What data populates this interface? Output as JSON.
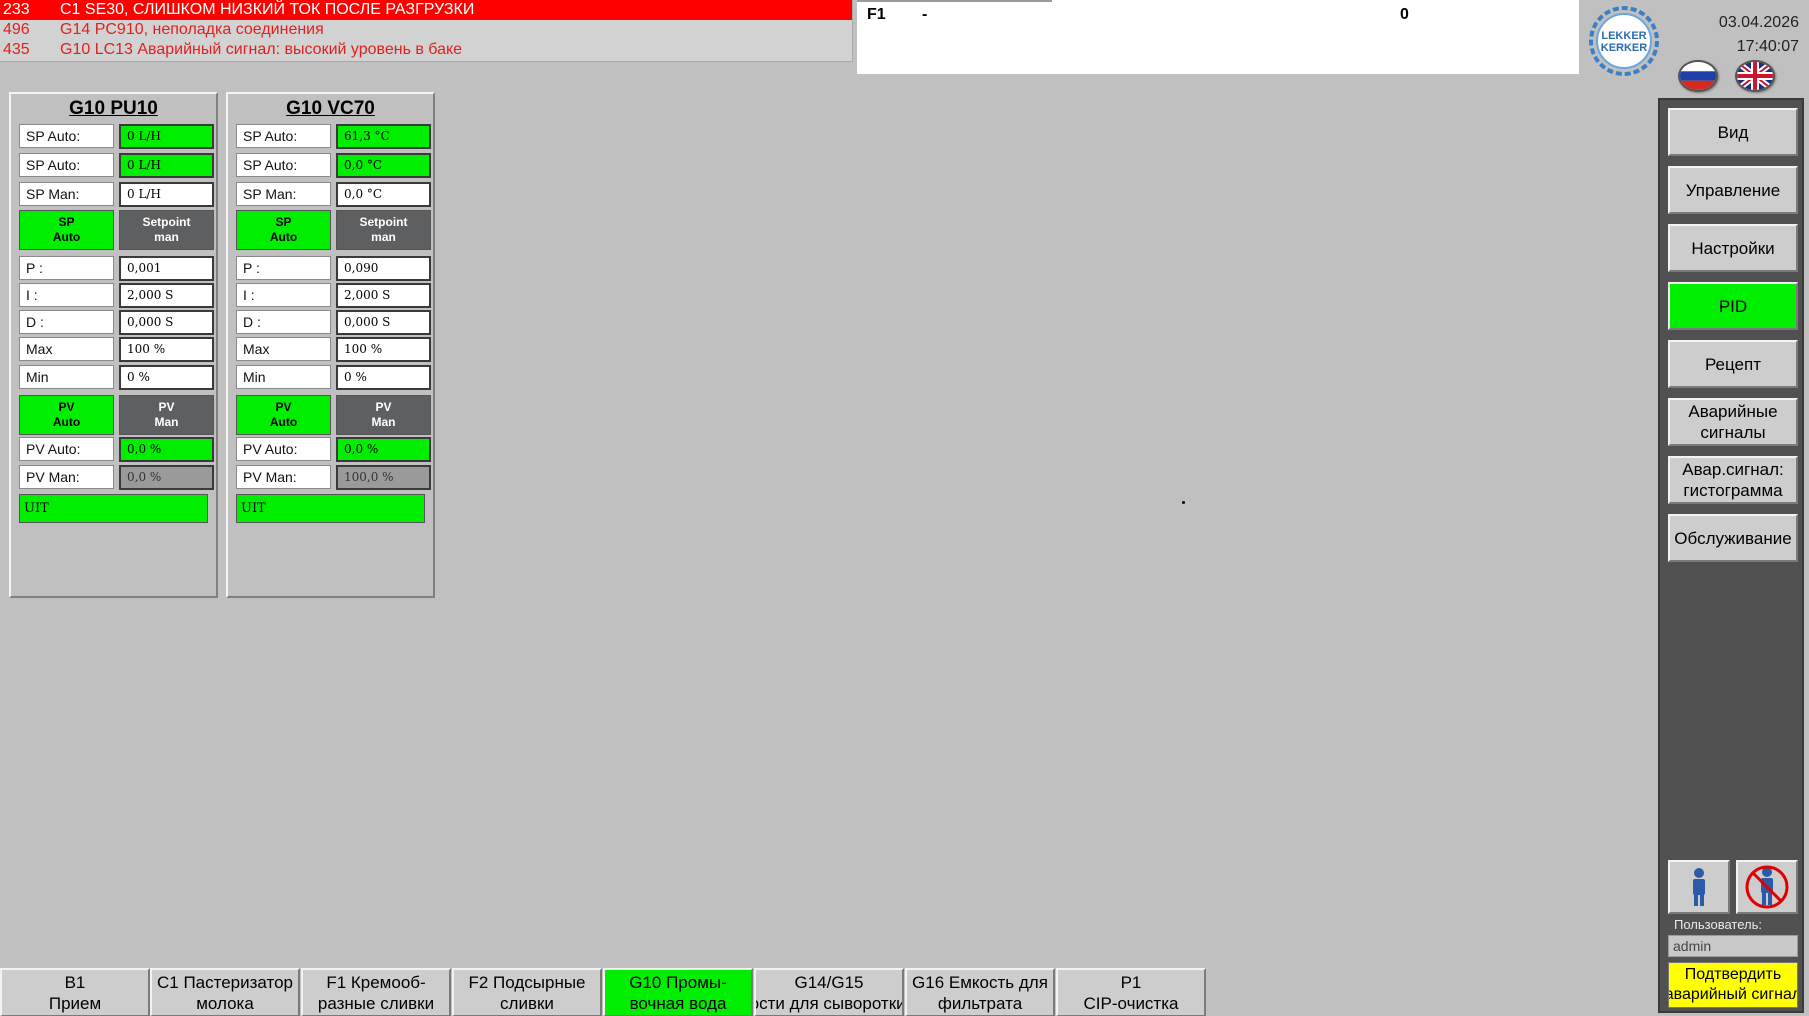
{
  "alarms": [
    {
      "id": "233",
      "text": "C1 SE30, СЛИШКОМ НИЗКИЙ ТОК ПОСЛЕ РАЗГРУЗКИ"
    },
    {
      "id": "496",
      "text": "G14 PC910, неполадка соединения"
    },
    {
      "id": "435",
      "text": "G10 LC13 Аварийный сигнал: высокий уровень в баке"
    }
  ],
  "info": {
    "code": "F1",
    "dash": "-",
    "count": "0"
  },
  "header": {
    "date": "03.04.2026",
    "time": "17:40:07",
    "logo_icon": "lekker-kerker-logo",
    "logo_text_1": "LEKKER",
    "logo_text_2": "KERKER",
    "flags": [
      "russian-flag-icon",
      "uk-flag-icon"
    ]
  },
  "pid_panels": [
    {
      "title": "G10 PU10",
      "sp_auto_label": "SP Auto:",
      "sp_auto_value": "0 L/H",
      "sp_auto2_label": "SP Auto:",
      "sp_auto2_value": "0 L/H",
      "sp_man_label": "SP Man:",
      "sp_man_value": "0 L/H",
      "sp_btn_line1": "SP",
      "sp_btn_line2": "Auto",
      "setpoint_btn_line1": "Setpoint",
      "setpoint_btn_line2": "man",
      "p_label": "P :",
      "p_value": "0,001",
      "i_label": "I :",
      "i_value": "2,000 S",
      "d_label": "D :",
      "d_value": "0,000 S",
      "max_label": "Max",
      "max_value": "100 %",
      "min_label": "Min",
      "min_value": "0 %",
      "pv_auto_btn_line1": "PV",
      "pv_auto_btn_line2": "Auto",
      "pv_man_btn_line1": "PV",
      "pv_man_btn_line2": "Man",
      "pv_auto_label": "PV Auto:",
      "pv_auto_value": "0,0 %",
      "pv_man_label": "PV Man:",
      "pv_man_value": "0,0 %",
      "uit": "UIT"
    },
    {
      "title": "G10 VC70",
      "sp_auto_label": "SP Auto:",
      "sp_auto_value": "61,3 °C",
      "sp_auto2_label": "SP Auto:",
      "sp_auto2_value": "0,0 °C",
      "sp_man_label": "SP Man:",
      "sp_man_value": "0,0 °C",
      "sp_btn_line1": "SP",
      "sp_btn_line2": "Auto",
      "setpoint_btn_line1": "Setpoint",
      "setpoint_btn_line2": "man",
      "p_label": "P :",
      "p_value": "0,090",
      "i_label": "I :",
      "i_value": "2,000 S",
      "d_label": "D :",
      "d_value": "0,000 S",
      "max_label": "Max",
      "max_value": "100 %",
      "min_label": "Min",
      "min_value": "0 %",
      "pv_auto_btn_line1": "PV",
      "pv_auto_btn_line2": "Auto",
      "pv_man_btn_line1": "PV",
      "pv_man_btn_line2": "Man",
      "pv_auto_label": "PV Auto:",
      "pv_auto_value": "0,0 %",
      "pv_man_label": "PV Man:",
      "pv_man_value": "100,0 %",
      "uit": "UIT"
    }
  ],
  "nav": {
    "items": [
      {
        "label": "Вид",
        "line2": ""
      },
      {
        "label": "Управление",
        "line2": ""
      },
      {
        "label": "Настройки",
        "line2": ""
      },
      {
        "label": "PID",
        "line2": ""
      },
      {
        "label": "Рецепт",
        "line2": ""
      },
      {
        "label": "Аварийные",
        "line2": "сигналы"
      },
      {
        "label": "Авар.сигнал:",
        "line2": "гистограмма"
      },
      {
        "label": "Обслуживание",
        "line2": ""
      }
    ],
    "active": "PID",
    "user_label": "Пользователь:",
    "user_value": "admin",
    "ack_line1": "Подтвердить",
    "ack_line2": "аварийный сигнал"
  },
  "bottom_tabs": [
    {
      "line1": "B1",
      "line2": "Прием"
    },
    {
      "line1": "C1 Пастеризатор",
      "line2": "молока"
    },
    {
      "line1": "F1 Кремооб-",
      "line2": "разные сливки"
    },
    {
      "line1": "F2 Подсырные",
      "line2": "сливки"
    },
    {
      "line1": "G10 Промы-",
      "line2": "вочная вода"
    },
    {
      "line1": "G14/G15",
      "line2": "Емкости для сыворотки/обр"
    },
    {
      "line1": "G16 Емкость для",
      "line2": "фильтрата"
    },
    {
      "line1": "P1",
      "line2": "CIP-очистка"
    }
  ],
  "active_tab": "G10 Промы-",
  "colors": {
    "active_green": "#00ee00",
    "alarm_red": "#ff0000",
    "ack_yellow": "#ffff00",
    "nav_bg": "#515151",
    "panel_gray": "#c0c0c0"
  }
}
